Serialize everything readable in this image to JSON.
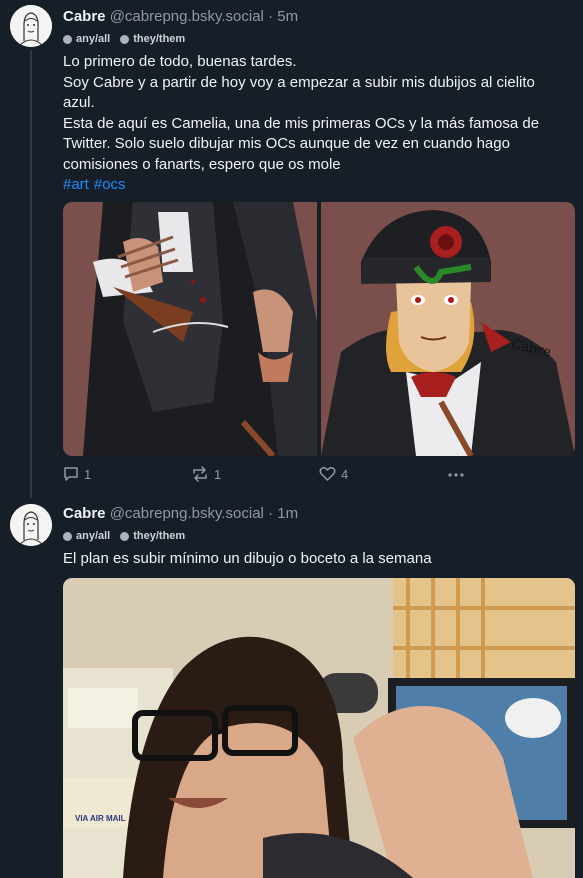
{
  "posts": [
    {
      "author": "Cabre",
      "handle": "@cabrepng.bsky.social",
      "time": "· 5m",
      "labels": [
        "any/all",
        "they/them"
      ],
      "text_lines": [
        "Lo primero de todo, buenas tardes.",
        "Soy Cabre y a partir de hoy voy a empezar a subir mis dubijos al cielito azul.",
        "Esta de aquí es Camelia, una de mis primeras OCs y la más famosa de Twitter. Solo suelo dibujar mis OCs aunque de vez en cuando hago comisiones o fanarts, espero que os mole"
      ],
      "tags": [
        "#art",
        "#ocs"
      ],
      "signature": "Cabre",
      "counts": {
        "replies": "1",
        "reposts": "1",
        "likes": "4"
      }
    },
    {
      "author": "Cabre",
      "handle": "@cabrepng.bsky.social",
      "time": "· 1m",
      "labels": [
        "any/all",
        "they/them"
      ],
      "text_lines": [
        "El plan es subir mínimo un dibujo o boceto a la semana"
      ],
      "photo_text": {
        "note": "VIA AIR MAIL"
      }
    }
  ],
  "colors": {
    "background": "#161e27",
    "link": "#208bfe",
    "muted": "#8d9aab"
  }
}
